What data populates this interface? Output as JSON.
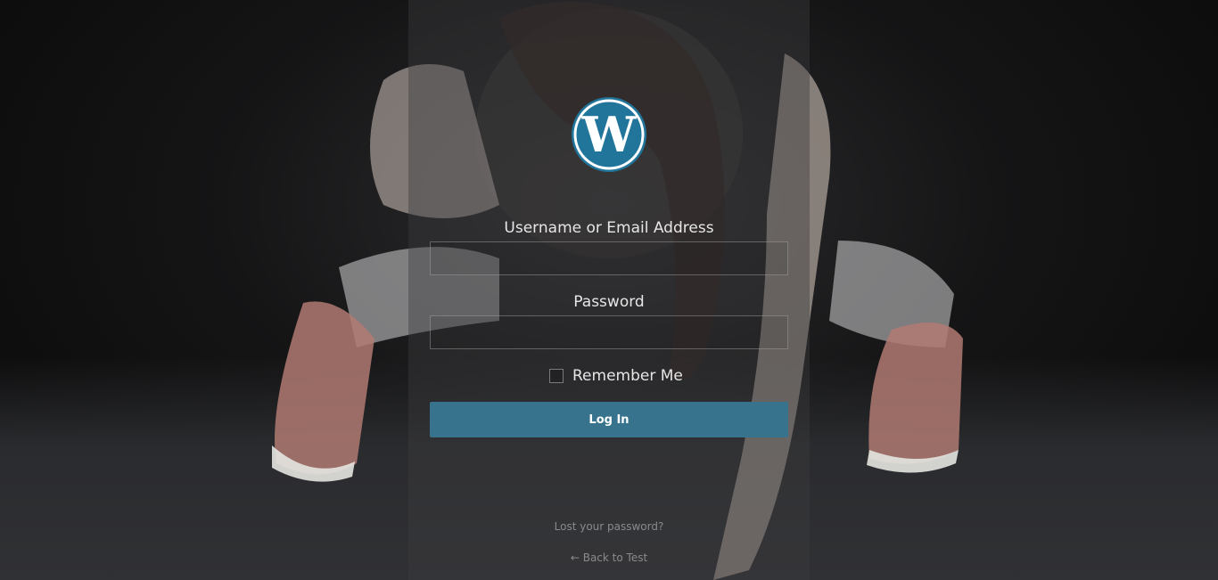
{
  "form": {
    "username_label": "Username or Email Address",
    "username_value": "",
    "password_label": "Password",
    "password_value": "",
    "remember_label": "Remember Me",
    "remember_checked": false,
    "login_label": "Log In"
  },
  "links": {
    "lost_password": "Lost your password?",
    "back_to_site": "← Back to Test"
  },
  "logo": {
    "icon": "wordpress-logo-icon",
    "color": "#21759b"
  },
  "colors": {
    "button": "#37738d",
    "panel_overlay": "rgba(60,60,62,0.42)"
  }
}
